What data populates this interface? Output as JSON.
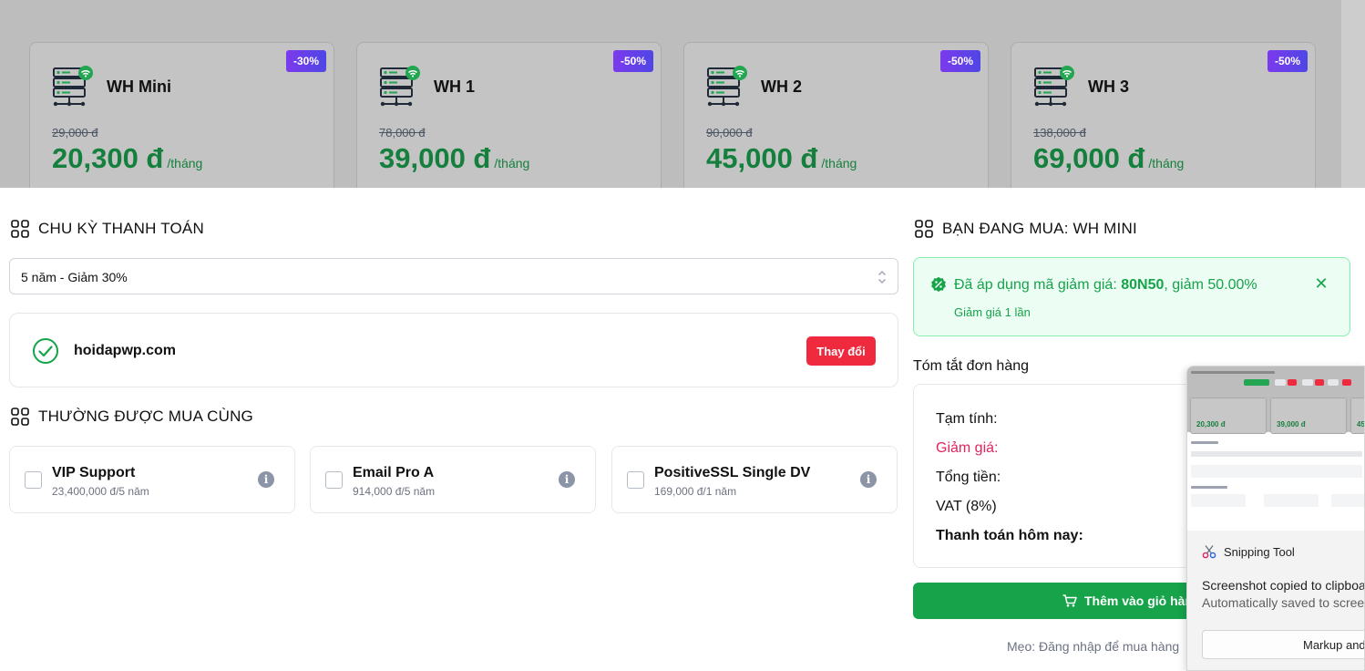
{
  "plans": [
    {
      "name": "WH Mini",
      "badge": "-30%",
      "old_price": "29,000 đ",
      "price": "20,300 đ",
      "unit": "/tháng"
    },
    {
      "name": "WH 1",
      "badge": "-50%",
      "old_price": "78,000 đ",
      "price": "39,000 đ",
      "unit": "/tháng"
    },
    {
      "name": "WH 2",
      "badge": "-50%",
      "old_price": "90,000 đ",
      "price": "45,000 đ",
      "unit": "/tháng"
    },
    {
      "name": "WH 3",
      "badge": "-50%",
      "old_price": "138,000 đ",
      "price": "69,000 đ",
      "unit": "/tháng"
    }
  ],
  "billing": {
    "title": "CHU KỲ THANH TOÁN",
    "selected": "5 năm - Giảm 30%"
  },
  "domain": {
    "name": "hoidapwp.com",
    "change_label": "Thay đổi"
  },
  "addons": {
    "title": "THƯỜNG ĐƯỢC MUA CÙNG",
    "items": [
      {
        "name": "VIP Support",
        "price": "23,400,000 đ/5 năm"
      },
      {
        "name": "Email Pro A",
        "price": "914,000 đ/5 năm"
      },
      {
        "name": "PositiveSSL Single DV",
        "price": "169,000 đ/1 năm"
      }
    ]
  },
  "order": {
    "title": "BẠN ĐANG MUA: WH MINI",
    "coupon": {
      "prefix": "Đã áp dụng mã giảm giá: ",
      "code": "80N50",
      "suffix": ", giảm 50.00%",
      "note": "Giảm giá 1 lần"
    },
    "summary_title": "Tóm tắt đơn hàng",
    "rows": {
      "subtotal": "Tạm tính:",
      "discount": "Giảm giá:",
      "total": "Tổng tiền:",
      "vat": "VAT (8%)",
      "pay_today": "Thanh toán hôm nay:"
    },
    "cart_button": "Thêm vào giỏ hàng",
    "tip": "Mẹo: Đăng nhập để mua hàng"
  },
  "toast": {
    "app_name": "Snipping Tool",
    "message": "Screenshot copied to clipboard",
    "sub_message": "Automatically saved to screenshots folder",
    "button": "Markup and share",
    "thumb": {
      "price_1": "20,300 đ",
      "price_2": "39,000 đ",
      "price_3": "45,0"
    }
  },
  "colors": {
    "accent_green": "#16a34a",
    "price_green": "#15803d",
    "danger_red": "#ef2a3e",
    "discount_pink": "#e0245e",
    "badge_purple": "#7c3aed"
  }
}
